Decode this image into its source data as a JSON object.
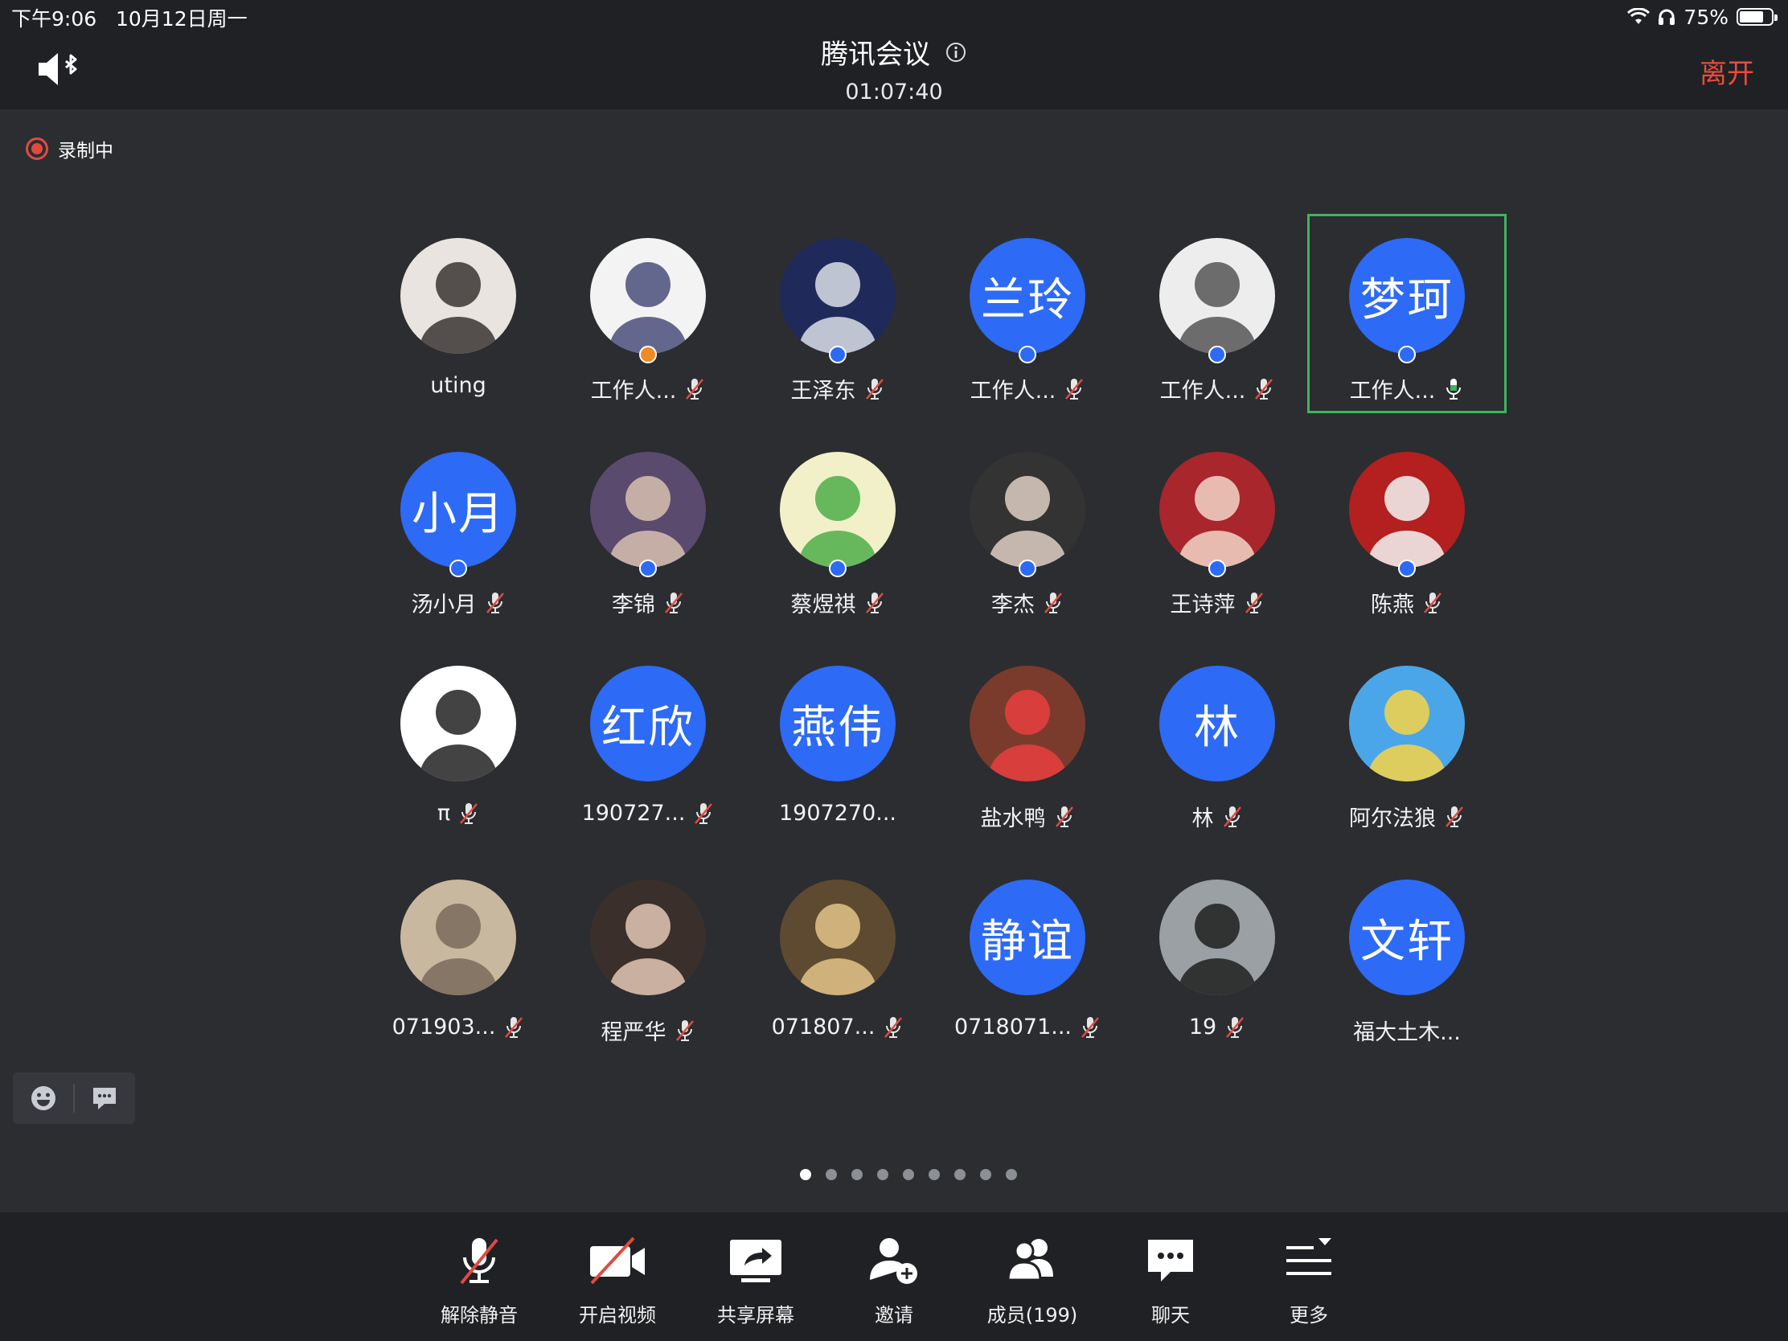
{
  "status_bar": {
    "time": "下午9:06",
    "date": "10月12日周一",
    "battery": "75%",
    "battery_level": 0.75
  },
  "meeting": {
    "title": "腾讯会议",
    "timer": "01:07:40",
    "leave_label": "离开",
    "recording_label": "录制中"
  },
  "colors": {
    "accent": "#2d6af6",
    "leave": "#e84c3d",
    "active_border": "#3fb45e",
    "background": "#2b2d31"
  },
  "participants": [
    {
      "name": "uting",
      "avatar": "photo",
      "mic": "none",
      "host": false
    },
    {
      "name": "工作人...",
      "avatar": "photo",
      "mic": "muted",
      "host": true,
      "host_color": "orange"
    },
    {
      "name": "王泽东",
      "avatar": "photo",
      "mic": "muted",
      "host": true
    },
    {
      "name": "工作人...",
      "avatar": "兰玲",
      "mic": "muted",
      "host": true
    },
    {
      "name": "工作人...",
      "avatar": "photo",
      "mic": "muted",
      "host": true
    },
    {
      "name": "工作人...",
      "avatar": "梦珂",
      "mic": "on",
      "host": true,
      "active": true
    },
    {
      "name": "汤小月",
      "avatar": "小月",
      "mic": "muted",
      "host": true
    },
    {
      "name": "李锦",
      "avatar": "photo",
      "mic": "muted",
      "host": true
    },
    {
      "name": "蔡煜祺",
      "avatar": "photo",
      "mic": "muted",
      "host": true
    },
    {
      "name": "李杰",
      "avatar": "photo",
      "mic": "muted",
      "host": true
    },
    {
      "name": "王诗萍",
      "avatar": "photo",
      "mic": "muted",
      "host": true
    },
    {
      "name": "陈燕",
      "avatar": "photo",
      "mic": "muted",
      "host": true
    },
    {
      "name": "π",
      "avatar": "photo",
      "mic": "muted",
      "host": false
    },
    {
      "name": "190727...",
      "avatar": "红欣",
      "mic": "muted",
      "host": false
    },
    {
      "name": "1907270...",
      "avatar": "燕伟",
      "mic": "none",
      "host": false
    },
    {
      "name": "盐水鸭",
      "avatar": "photo",
      "mic": "muted",
      "host": false
    },
    {
      "name": "林",
      "avatar": "林",
      "mic": "muted",
      "host": false
    },
    {
      "name": "阿尔法狼",
      "avatar": "photo",
      "mic": "muted",
      "host": false
    },
    {
      "name": "071903...",
      "avatar": "photo",
      "mic": "muted",
      "host": false
    },
    {
      "name": "程严华",
      "avatar": "photo",
      "mic": "muted",
      "host": false
    },
    {
      "name": "071807...",
      "avatar": "photo",
      "mic": "muted",
      "host": false
    },
    {
      "name": "0718071...",
      "avatar": "静谊",
      "mic": "muted",
      "host": false
    },
    {
      "name": "19",
      "avatar": "photo",
      "mic": "muted",
      "host": false
    },
    {
      "name": "福大土木...",
      "avatar": "文轩",
      "mic": "none",
      "host": false
    }
  ],
  "pagination": {
    "total": 9,
    "current": 1
  },
  "toolbar": {
    "unmute": "解除静音",
    "video": "开启视频",
    "share": "共享屏幕",
    "invite": "邀请",
    "members": "成员(199)",
    "chat": "聊天",
    "more": "更多"
  },
  "icons": {
    "speaker": "speaker-bluetooth-icon",
    "info": "info-icon",
    "emoji": "emoji-icon",
    "danmaku": "chat-bubble-icon"
  }
}
